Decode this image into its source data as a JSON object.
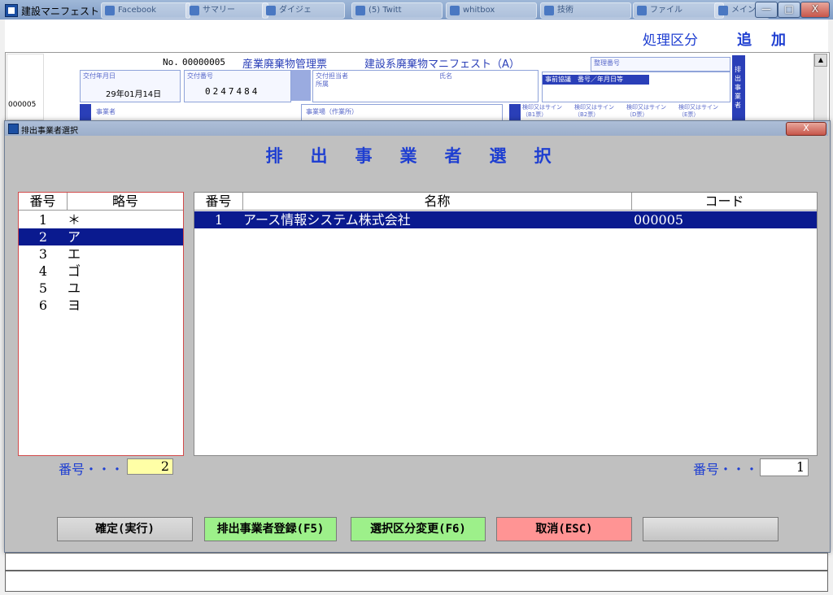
{
  "window": {
    "title": "建設マニフェスト",
    "background_tabs": [
      "Facebook",
      "サマリー",
      "ダイジェ",
      "(5) Twitt",
      "whitbox",
      "技術",
      "ファイル",
      "メイン"
    ],
    "controls": {
      "minimize": "—",
      "maximize": "□",
      "close": "X"
    }
  },
  "top": {
    "process_label": "処理区分",
    "process_value": "追加"
  },
  "manifest": {
    "no_label": "No.",
    "no_value": "00000005",
    "title_main": "産業廃棄物管理票",
    "title_sub": "建設系廃棄物マニフェスト（A）",
    "issue_date_label": "交付年月日",
    "issue_date_value": "29年01月14日",
    "issue_no_label": "交付番号",
    "issue_no_value": "0247484",
    "person_label": "交付担当者",
    "dept_label": "所属",
    "name_label": "氏名",
    "ref_label": "整理番号",
    "prior_label": "事前協議　番号／年月日等",
    "company_id": "000005",
    "biz_label": "事業者",
    "site_label": "事業場（作業所）",
    "stamp_labels": [
      "検印又はサイン（B1票）",
      "検印又はサイン（B2票）",
      "検印又はサイン（D票）",
      "検印又はサイン（E票）"
    ],
    "side_label": "排出事業者"
  },
  "dialog": {
    "title": "排出事業者選択",
    "heading": "排出事業者選択",
    "close": "X",
    "left_list": {
      "headers": {
        "num": "番号",
        "abbr": "略号"
      },
      "rows": [
        {
          "num": "1",
          "abbr": "＊",
          "selected": false
        },
        {
          "num": "2",
          "abbr": "ア",
          "selected": true
        },
        {
          "num": "3",
          "abbr": "エ",
          "selected": false
        },
        {
          "num": "4",
          "abbr": "ゴ",
          "selected": false
        },
        {
          "num": "5",
          "abbr": "ユ",
          "selected": false
        },
        {
          "num": "6",
          "abbr": "ヨ",
          "selected": false
        }
      ]
    },
    "right_list": {
      "headers": {
        "num": "番号",
        "name": "名称",
        "code": "コード"
      },
      "rows": [
        {
          "num": "1",
          "name": "アース情報システム株式会社",
          "code": "000005",
          "selected": true
        }
      ]
    },
    "left_number": {
      "label": "番号・・・",
      "value": "2"
    },
    "right_number": {
      "label": "番号・・・",
      "value": "1"
    },
    "buttons": {
      "confirm": "確定(実行)",
      "register": "排出事業者登録(F5)",
      "change": "選択区分変更(F6)",
      "cancel": "取消(ESC)",
      "blank": ""
    }
  }
}
